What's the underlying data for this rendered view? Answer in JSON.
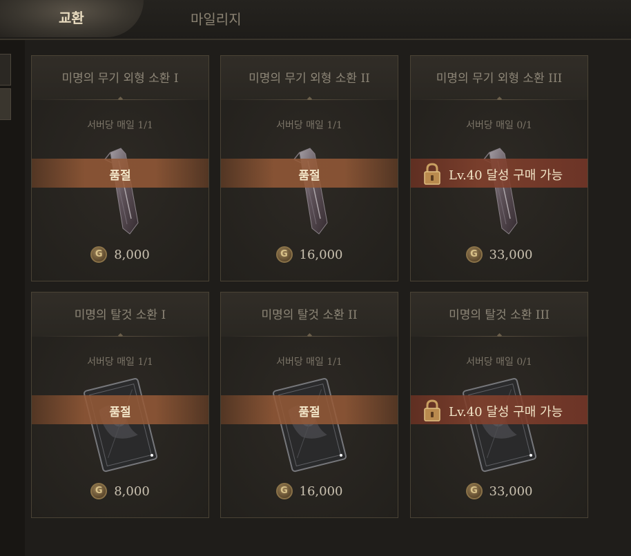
{
  "tabs": {
    "exchange": "교환",
    "mileage": "마일리지"
  },
  "coin_glyph": "G",
  "cards": [
    {
      "title": "미명의 무기 외형 소환 I",
      "limit": "서버당 매일 1/1",
      "status": "품절",
      "price": "8,000",
      "item": "weapon-shard-icon"
    },
    {
      "title": "미명의 무기 외형 소환 II",
      "limit": "서버당 매일 1/1",
      "status": "품절",
      "price": "16,000",
      "item": "weapon-shard-icon"
    },
    {
      "title": "미명의 무기 외형 소환 III",
      "limit": "서버당 매일 0/1",
      "status": "Lv.40 달성 구매 가능",
      "price": "33,000",
      "item": "weapon-shard-icon",
      "locked": true
    },
    {
      "title": "미명의 탈것 소환 I",
      "limit": "서버당 매일 1/1",
      "status": "품절",
      "price": "8,000",
      "item": "mount-card-icon"
    },
    {
      "title": "미명의 탈것 소환 II",
      "limit": "서버당 매일 1/1",
      "status": "품절",
      "price": "16,000",
      "item": "mount-card-icon"
    },
    {
      "title": "미명의 탈것 소환 III",
      "limit": "서버당 매일 0/1",
      "status": "Lv.40 달성 구매 가능",
      "price": "33,000",
      "item": "mount-card-icon",
      "locked": true
    }
  ],
  "colors": {
    "accent": "#e9dcc0",
    "band": "#96593a",
    "locked_band": "#824131"
  }
}
